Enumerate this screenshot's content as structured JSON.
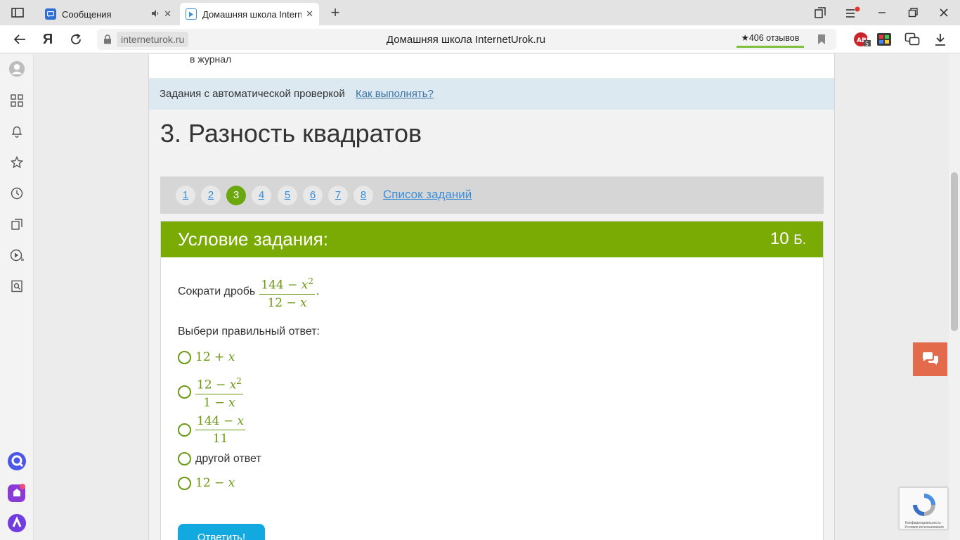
{
  "browser": {
    "tabs": [
      {
        "title": "Сообщения",
        "active": false
      },
      {
        "title": "Домашняя школа InternetUrok.ru",
        "active": true
      }
    ],
    "url_host": "interneturok.ru",
    "page_title": "Домашняя школа InternetUrok.ru",
    "reviews": "★406 отзывов",
    "yandex_letter": "Я"
  },
  "page": {
    "journal_text": "в журнал",
    "auto_check": "Задания с автоматической проверкой",
    "how_to": "Как выполнять?",
    "heading": "3. Разность квадратов",
    "pager": {
      "pages": [
        "1",
        "2",
        "3",
        "4",
        "5",
        "6",
        "7",
        "8"
      ],
      "current": "3",
      "list_label": "Список заданий"
    },
    "task": {
      "header": "Условие задания:",
      "points": "10",
      "points_unit": "Б.",
      "question_prefix": "Сократи дробь",
      "question_fraction": {
        "num_a": "144 − ",
        "num_var": "x",
        "num_exp": "2",
        "den_a": "12 − ",
        "den_var": "x"
      },
      "question_suffix": ".",
      "choose_label": "Выбери правильный ответ:",
      "options": [
        {
          "a": "12 + ",
          "var": "x"
        },
        {
          "num_a": "12 − ",
          "num_var": "x",
          "num_exp": "2",
          "den_a": "1 − ",
          "den_var": "x"
        },
        {
          "num_a": "144 − ",
          "num_var": "x",
          "den": "11"
        },
        {
          "text": "другой ответ"
        },
        {
          "a": "12 − ",
          "var": "x"
        }
      ],
      "submit_label": "Ответить!"
    },
    "recaptcha_text": "Конфиденциальность - Условия использования"
  },
  "colors": {
    "accent_green": "#7aab05",
    "link_blue": "#3b8fd9",
    "submit_blue": "#12a8e0",
    "chat_orange": "#e36a4a"
  }
}
